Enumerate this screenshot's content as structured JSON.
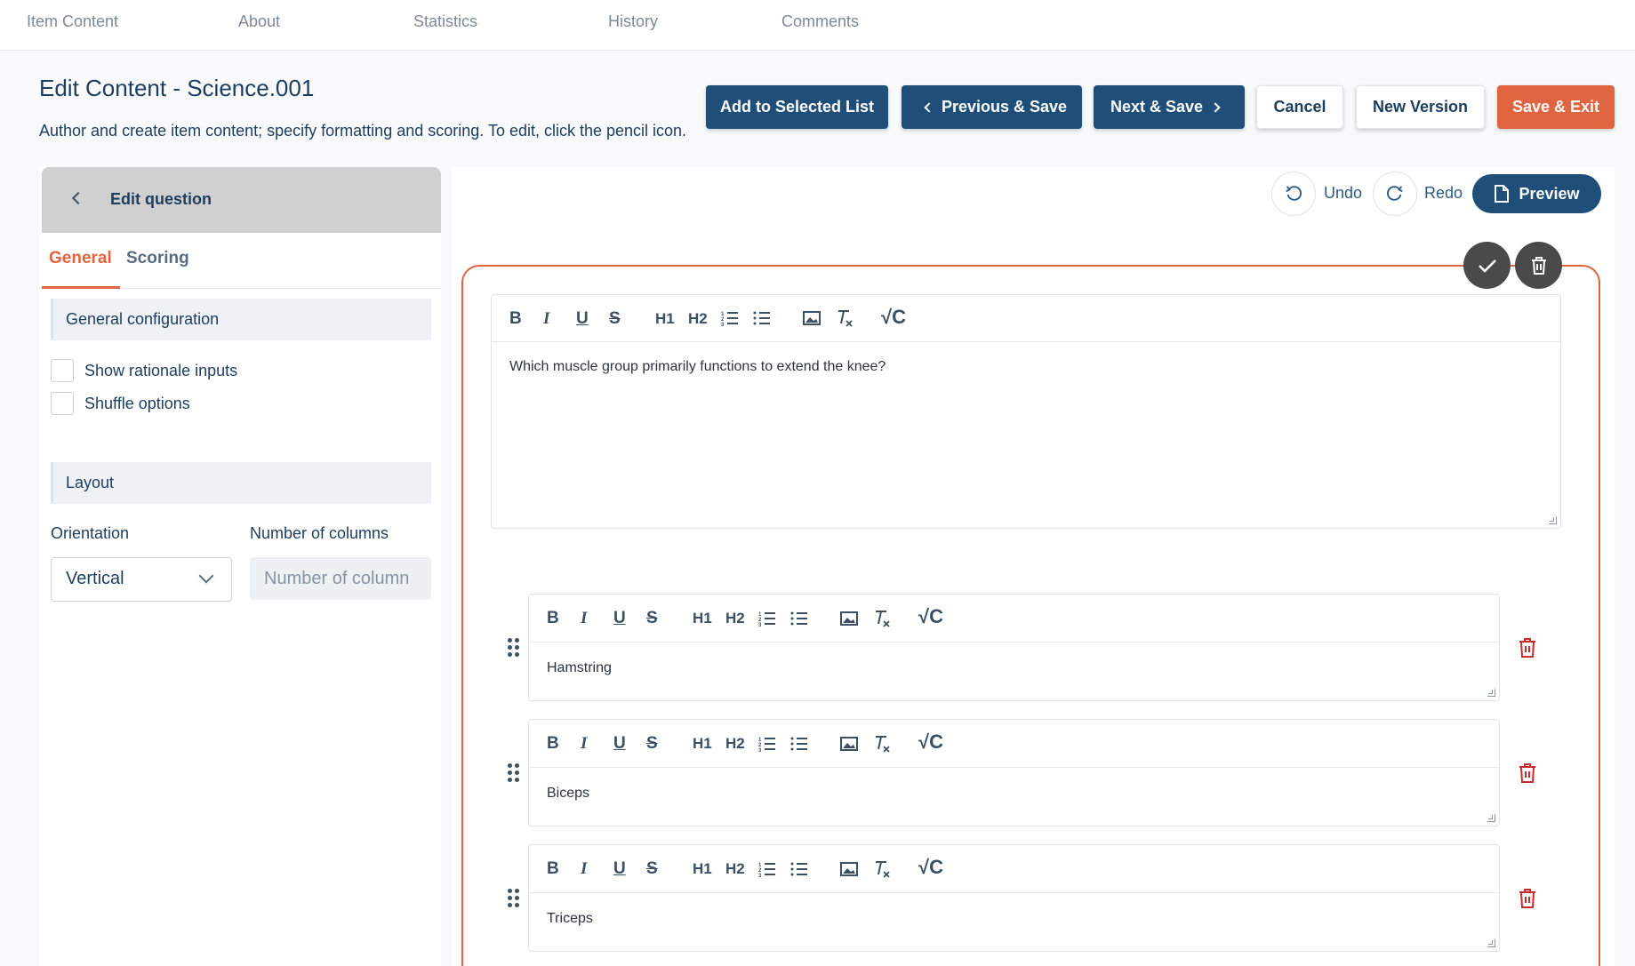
{
  "topnav": {
    "tabs": [
      "Item Content",
      "About",
      "Statistics",
      "History",
      "Comments"
    ]
  },
  "header": {
    "title": "Edit Content - Science.001",
    "description": "Author and create item content; specify formatting and scoring. To edit, click the pencil icon.",
    "buttons": {
      "add_to_list": "Add to Selected List",
      "previous_save": "Previous & Save",
      "next_save": "Next & Save",
      "cancel": "Cancel",
      "new_version": "New Version",
      "save_exit": "Save & Exit"
    }
  },
  "left_panel": {
    "title": "Edit question",
    "tabs": {
      "general": "General",
      "scoring": "Scoring"
    },
    "general_config": {
      "heading": "General configuration",
      "show_rationale": "Show rationale inputs",
      "shuffle_options": "Shuffle options"
    },
    "layout": {
      "heading": "Layout",
      "orientation_label": "Orientation",
      "orientation_value": "Vertical",
      "columns_label": "Number of columns",
      "columns_placeholder": "Number of column"
    }
  },
  "right_panel": {
    "undo": "Undo",
    "redo": "Redo",
    "preview": "Preview",
    "toolbar_glyphs": {
      "bold": "B",
      "italic": "I",
      "underline": "U",
      "strike": "S",
      "h1": "H1",
      "h2": "H2",
      "formula": "√C"
    },
    "question_text": "Which muscle group primarily functions to extend the knee?",
    "options": [
      "Hamstring",
      "Biceps",
      "Triceps"
    ]
  },
  "colors": {
    "primary": "#1f4f78",
    "accent": "#e0643f",
    "danger": "#c92a2a"
  }
}
